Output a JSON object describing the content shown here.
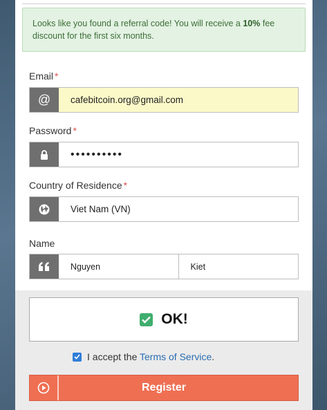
{
  "alert": {
    "text_before": "Looks like you found a referral code! You will receive a ",
    "discount": "10%",
    "text_after": " fee discount for the first six months."
  },
  "email": {
    "label": "Email",
    "required": "*",
    "value": "cafebitcoin.org@gmail.com",
    "addon": "@"
  },
  "password": {
    "label": "Password",
    "required": "*",
    "value": "••••••••••"
  },
  "country": {
    "label": "Country of Residence",
    "required": "*",
    "value": "Viet Nam (VN)"
  },
  "name": {
    "label": "Name",
    "first": "Nguyen",
    "last": "Kiet"
  },
  "captcha": {
    "status": "OK!"
  },
  "terms": {
    "prefix": "I accept the ",
    "link": "Terms of Service",
    "suffix": "."
  },
  "register": {
    "label": "Register"
  },
  "colors": {
    "accent": "#ef6f53",
    "alert_bg": "#e3f2e3",
    "captcha_ok": "#3fae6e",
    "link": "#2a6db0"
  }
}
